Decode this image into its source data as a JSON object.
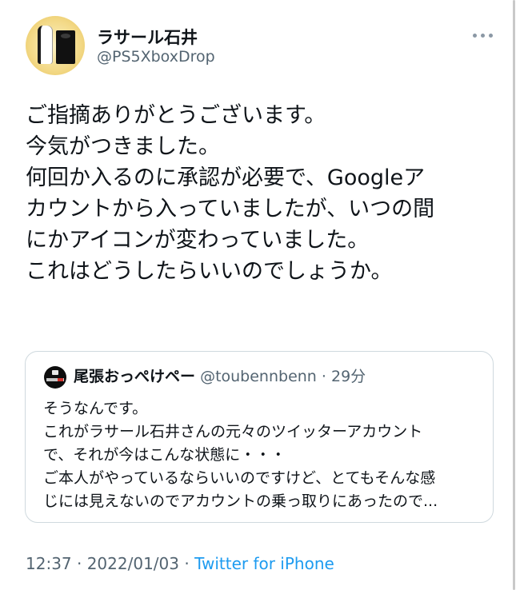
{
  "author": {
    "display_name": "ラサール石井",
    "handle": "@PS5XboxDrop"
  },
  "tweet": {
    "lines": [
      "ご指摘ありがとうございます。",
      "今気がつきました。",
      "何回か入るのに承認が必要で、Googleア",
      "カウントから入っていましたが、いつの間",
      "にかアイコンが変わっていました。",
      "これはどうしたらいいのでしょうか。"
    ]
  },
  "quote": {
    "display_name": "尾張おっぺけペー",
    "handle": "@toubennbenn",
    "separator": "·",
    "time": "29分",
    "lines": [
      "そうなんです。",
      "これがラサール石井さんの元々のツイッターアカウント",
      "で、それが今はこんな状態に・・・",
      "ご本人がやっているならいいのですけど、とてもそんな感",
      "じには見えないのでアカウントの乗っ取りにあったので..."
    ]
  },
  "meta": {
    "timestamp": "12:37 · 2022/01/03 · ",
    "source": "Twitter for iPhone"
  },
  "icons": {
    "more": "more-horizontal-icon",
    "author_avatar": "ps5-xbox-avatar",
    "quote_avatar": "quote-author-avatar"
  },
  "colors": {
    "text": "#0f1419",
    "secondary": "#536471",
    "link": "#1d9bf0",
    "border": "#cfd9de",
    "more_icon": "#8b98a5"
  }
}
